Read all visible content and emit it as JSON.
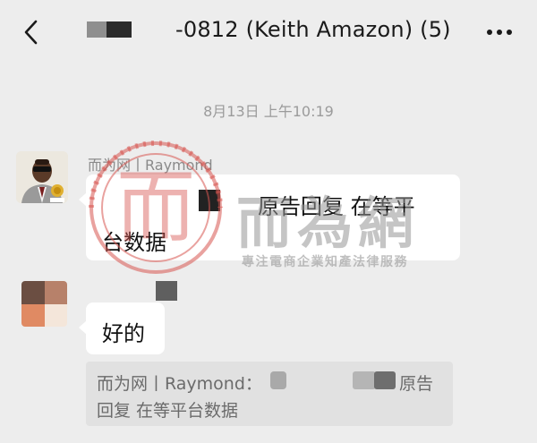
{
  "header": {
    "title": "-0812 (Keith Amazon) (5)",
    "back_icon": "back-chevron-icon",
    "more_icon": "more-dots-icon"
  },
  "chat": {
    "timestamp": "8月13日 上午10:19",
    "messages": [
      {
        "sender": "而为网丨Raymond",
        "text_line1": "原告回复  在等平",
        "text_line2": "台数据"
      },
      {
        "sender": "",
        "text": "好的"
      }
    ],
    "quote": {
      "line1_prefix": "而为网丨Raymond：",
      "line1_suffix": "原告",
      "line2": "回复  在等平台数据"
    }
  },
  "watermark": {
    "logo_text": "而",
    "title": "而為網",
    "subtitle": "專注電商企業知產法律服務"
  },
  "colors": {
    "background": "#ededed",
    "bubble": "#ffffff",
    "quote_bg": "#e1e1e1",
    "watermark_red": "#d9534f"
  }
}
